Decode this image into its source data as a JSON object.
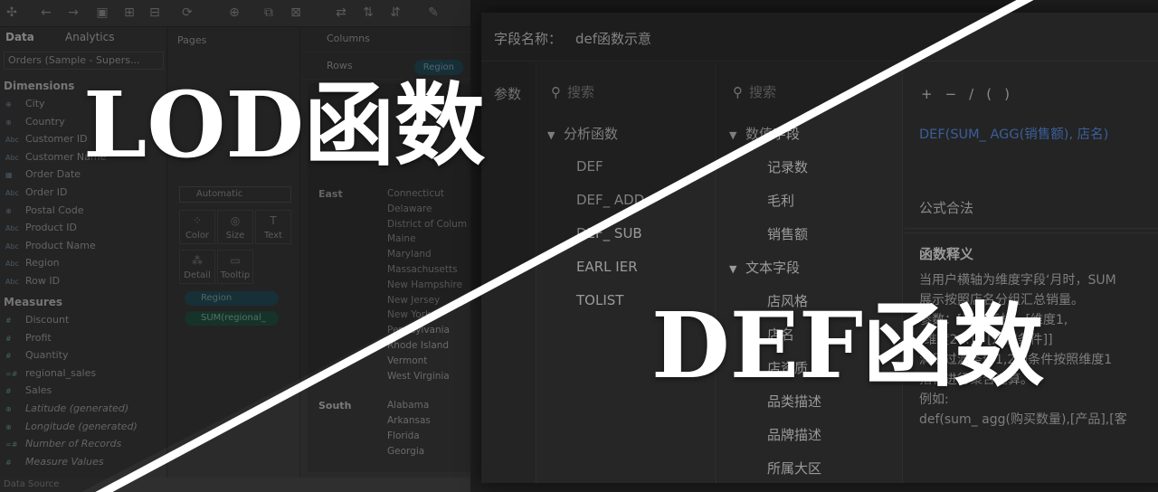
{
  "tableau": {
    "pane_tabs": [
      "Data",
      "Analytics"
    ],
    "datasource": "Orders (Sample - Supers...",
    "pages_label": "Pages",
    "shelves": {
      "columns": "Columns",
      "rows": "Rows",
      "rows_pill": "Region"
    },
    "dimensions_label": "Dimensions",
    "dimensions": [
      {
        "type": "⊕",
        "name": "City"
      },
      {
        "type": "⊕",
        "name": "Country"
      },
      {
        "type": "Abc",
        "name": "Customer ID"
      },
      {
        "type": "Abc",
        "name": "Customer Name"
      },
      {
        "type": "▦",
        "name": "Order Date"
      },
      {
        "type": "Abc",
        "name": "Order ID"
      },
      {
        "type": "⊕",
        "name": "Postal Code"
      },
      {
        "type": "Abc",
        "name": "Product ID"
      },
      {
        "type": "Abc",
        "name": "Product Name"
      },
      {
        "type": "Abc",
        "name": "Region"
      },
      {
        "type": "Abc",
        "name": "Row ID"
      }
    ],
    "measures_label": "Measures",
    "measures": [
      {
        "type": "#",
        "name": "Discount",
        "italic": false
      },
      {
        "type": "#",
        "name": "Profit",
        "italic": false
      },
      {
        "type": "#",
        "name": "Quantity",
        "italic": false
      },
      {
        "type": "=#",
        "name": "regional_sales",
        "italic": false
      },
      {
        "type": "#",
        "name": "Sales",
        "italic": false
      },
      {
        "type": "⊕",
        "name": "Latitude (generated)",
        "italic": true
      },
      {
        "type": "⊕",
        "name": "Longitude (generated)",
        "italic": true
      },
      {
        "type": "=#",
        "name": "Number of Records",
        "italic": true
      },
      {
        "type": "#",
        "name": "Measure Values",
        "italic": true
      }
    ],
    "marks": {
      "type": "Automatic",
      "buttons": [
        "Color",
        "Size",
        "Text",
        "Detail",
        "Tooltip"
      ],
      "pills": [
        "Region",
        "SUM(regional_"
      ]
    },
    "viz": {
      "regions": [
        {
          "name": "East",
          "states": [
            "Connecticut",
            "Delaware",
            "District of Colum",
            "Maine",
            "Maryland",
            "Massachusetts",
            "New Hampshire",
            "New Jersey",
            "New York",
            "Pennsylvania",
            "Rhode Island",
            "Vermont",
            "West Virginia"
          ]
        },
        {
          "name": "South",
          "states": [
            "Alabama",
            "Arkansas",
            "Florida",
            "Georgia"
          ]
        }
      ]
    },
    "bottom_tab": "Data Source"
  },
  "dialog": {
    "title_label": "字段名称：",
    "title_value": "def函数示意",
    "param_label": "参数",
    "search_placeholder": "搜索",
    "func_group": "分析函数",
    "functions": [
      "DEF",
      "DEF_ ADD",
      "DEF_ SUB",
      "EARL IER",
      "TOLIST"
    ],
    "field_groups": [
      {
        "name": "数值字段",
        "items": [
          "记录数",
          "毛利",
          "销售额"
        ]
      },
      {
        "name": "文本字段",
        "items": [
          "店风格",
          "店名",
          "店资质",
          "品类描述",
          "品牌描述",
          "所属大区"
        ]
      }
    ],
    "operators": [
      "+",
      "−",
      "/",
      "(",
      ")"
    ],
    "formula": "DEF(SUM_ AGG(销售额), 店名)",
    "status": "公式合法",
    "desc_title": "函数释义",
    "desc_lines": [
      "当用户横轴为维度字段‘月时，SUM",
      "展示按照店名分组汇总销量。",
      "参数：[聚合指标，[维度1,",
      "[维度2...]，[过滤条件]]",
      "满足过滤条件1,2的条件按照维度1",
      "指标进行聚合运算。",
      "例如:",
      "def(sum_ agg(购买数量),[产品],[客"
    ]
  },
  "overlay": {
    "title_left": "LOD函数",
    "title_right": "DEF函数"
  }
}
